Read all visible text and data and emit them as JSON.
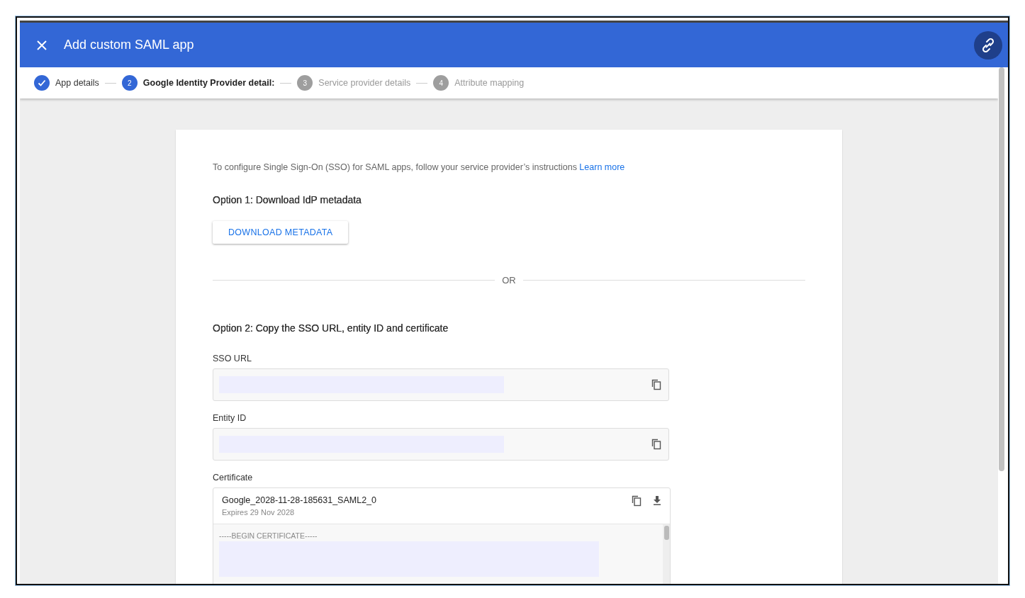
{
  "window": {
    "title": "Add custom SAML app"
  },
  "steps": [
    {
      "label": "App details",
      "completed": true,
      "selected": false
    },
    {
      "label": "Google Identity Provider detail:",
      "number": "2",
      "completed": false,
      "selected": true
    },
    {
      "label": "Service provider details",
      "number": "3",
      "completed": false,
      "selected": false
    },
    {
      "label": "Attribute mapping",
      "number": "4",
      "completed": false,
      "selected": false
    }
  ],
  "intro": {
    "text": "To configure Single Sign-On (SSO) for SAML apps, follow your service provider’s instructions",
    "link": "Learn more"
  },
  "option1": {
    "heading": "Option 1: Download IdP metadata",
    "button": "DOWNLOAD METADATA"
  },
  "divider_label": "OR",
  "option2": {
    "heading": "Option 2: Copy the SSO URL, entity ID and certificate"
  },
  "fields": [
    {
      "label": "SSO URL"
    },
    {
      "label": "Entity ID"
    }
  ],
  "certificate": {
    "label": "Certificate",
    "name": "Google_2028-11-28-185631_SAML2_0",
    "expires": "Expires 29 Nov 2028",
    "begin": "-----BEGIN CERTIFICATE-----"
  }
}
